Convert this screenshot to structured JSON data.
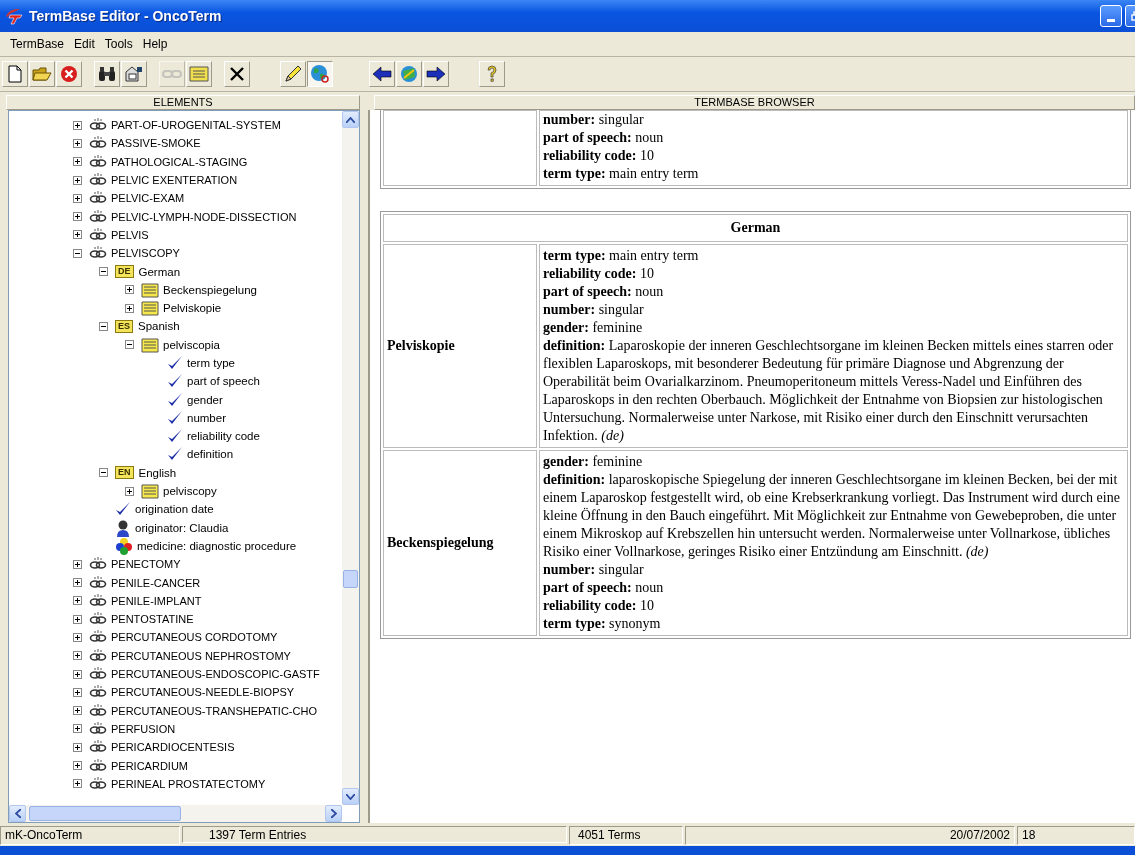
{
  "window": {
    "title": "TermBase Editor - OncoTerm"
  },
  "menu": [
    "TermBase",
    "Edit",
    "Tools",
    "Help"
  ],
  "toolbar": [
    [
      {
        "kind": "new"
      },
      {
        "kind": "open"
      },
      {
        "kind": "stop"
      }
    ],
    [
      {
        "kind": "find"
      },
      {
        "kind": "properties"
      }
    ],
    [
      {
        "kind": "link",
        "disabled": true
      },
      {
        "kind": "entry"
      }
    ],
    [
      {
        "kind": "delete"
      }
    ],
    [
      {
        "kind": "edit",
        "pressed": false
      },
      {
        "kind": "browse",
        "pressed": true
      }
    ],
    [
      {
        "kind": "back"
      },
      {
        "kind": "sync"
      },
      {
        "kind": "forward"
      }
    ],
    [
      {
        "kind": "help"
      }
    ]
  ],
  "tree": {
    "header": "ELEMENTS",
    "items": [
      {
        "kind": "concept",
        "label": "PART-OF-UROGENITAL-SYSTEM",
        "expanded": false
      },
      {
        "kind": "concept",
        "label": "PASSIVE-SMOKE",
        "expanded": false
      },
      {
        "kind": "concept",
        "label": "PATHOLOGICAL-STAGING",
        "expanded": false
      },
      {
        "kind": "concept",
        "label": "PELVIC EXENTERATION",
        "expanded": false
      },
      {
        "kind": "concept",
        "label": "PELVIC-EXAM",
        "expanded": false
      },
      {
        "kind": "concept",
        "label": "PELVIC-LYMPH-NODE-DISSECTION",
        "expanded": false
      },
      {
        "kind": "concept",
        "label": "PELVIS",
        "expanded": false
      },
      {
        "kind": "concept",
        "label": "PELVISCOPY",
        "expanded": true,
        "children": [
          {
            "kind": "language",
            "badge": "DE",
            "label": "German",
            "expanded": true,
            "children": [
              {
                "kind": "term",
                "label": "Beckenspiegelung",
                "expanded": false
              },
              {
                "kind": "term",
                "label": "Pelviskopie",
                "expanded": false
              }
            ]
          },
          {
            "kind": "language",
            "badge": "ES",
            "label": "Spanish",
            "expanded": true,
            "children": [
              {
                "kind": "term",
                "label": "pelviscopia",
                "expanded": true,
                "children": [
                  {
                    "kind": "field",
                    "label": "term type"
                  },
                  {
                    "kind": "field",
                    "label": "part of speech"
                  },
                  {
                    "kind": "field",
                    "label": "gender"
                  },
                  {
                    "kind": "field",
                    "label": "number"
                  },
                  {
                    "kind": "field",
                    "label": "reliability code"
                  },
                  {
                    "kind": "field",
                    "label": "definition"
                  }
                ]
              }
            ]
          },
          {
            "kind": "language",
            "badge": "EN",
            "label": "English",
            "expanded": true,
            "children": [
              {
                "kind": "term",
                "label": "pelviscopy",
                "expanded": false
              }
            ]
          },
          {
            "kind": "field",
            "label": "origination date"
          },
          {
            "kind": "person",
            "label": "originator: Claudia"
          },
          {
            "kind": "subject",
            "label": "medicine: diagnostic procedure"
          }
        ]
      },
      {
        "kind": "concept",
        "label": "PENECTOMY",
        "expanded": false
      },
      {
        "kind": "concept",
        "label": "PENILE-CANCER",
        "expanded": false
      },
      {
        "kind": "concept",
        "label": "PENILE-IMPLANT",
        "expanded": false
      },
      {
        "kind": "concept",
        "label": "PENTOSTATINE",
        "expanded": false
      },
      {
        "kind": "concept",
        "label": "PERCUTANEOUS CORDOTOMY",
        "expanded": false
      },
      {
        "kind": "concept",
        "label": "PERCUTANEOUS NEPHROSTOMY",
        "expanded": false
      },
      {
        "kind": "concept",
        "label": "PERCUTANEOUS-ENDOSCOPIC-GASTF",
        "expanded": false
      },
      {
        "kind": "concept",
        "label": "PERCUTANEOUS-NEEDLE-BIOPSY",
        "expanded": false
      },
      {
        "kind": "concept",
        "label": "PERCUTANEOUS-TRANSHEPATIC-CHO",
        "expanded": false
      },
      {
        "kind": "concept",
        "label": "PERFUSION",
        "expanded": false
      },
      {
        "kind": "concept",
        "label": "PERICARDIOCENTESIS",
        "expanded": false
      },
      {
        "kind": "concept",
        "label": "PERICARDIUM",
        "expanded": false
      },
      {
        "kind": "concept",
        "label": "PERINEAL PROSTATECTOMY",
        "expanded": false
      }
    ]
  },
  "browser": {
    "header": "TERMBASE BROWSER",
    "previous_fields": [
      "**number:** singular",
      "**part of speech:** noun",
      "**reliability code:** 10",
      "**term type:** main entry term"
    ],
    "language_table": {
      "title": "German",
      "terms": [
        {
          "term": "Pelviskopie",
          "fields": [
            "**term type:** main entry term",
            "**reliability code:** 10",
            "**part of speech:** noun",
            "**number:** singular",
            "**gender:** feminine",
            "**definition:** Laparoskopie der inneren Geschlechtsorgane im kleinen Becken mittels eines starren oder flexiblen Laparoskops, mit besonderer Bedeutung für primäre Diagnose und Abgrenzung der Operabilität beim Ovarialkarzinom. Pneumoperitoneum mittels Veress-Nadel und Einführen des Laparoskops in den rechten Oberbauch. Möglichkeit der Entnahme von Biopsien zur histologischen Untersuchung. Normalerweise unter Narkose, mit Risiko einer durch den Einschnitt verursachten Infektion. *(de)*"
          ]
        },
        {
          "term": "Beckenspiegelung",
          "fields": [
            "**gender:** feminine",
            "**definition:** laparoskopische Spiegelung der inneren Geschlechtsorgane im kleinen Becken, bei der mit einem Laparoskop festgestellt wird, ob eine Krebserkrankung vorliegt. Das Instrument wird durch eine kleine Öffnung in den Bauch eingeführt. Mit Möglichkeit zur Entnahme von Gewebeproben, die unter einem Mikroskop auf Krebszellen hin untersucht werden. Normalerweise unter Vollnarkose, übliches Risiko einer Vollnarkose, geringes Risiko einer Entzündung am Einschnitt. *(de)*",
            "**number:** singular",
            "**part of speech:** noun",
            "**reliability code:** 10",
            "**term type:** synonym"
          ]
        }
      ]
    }
  },
  "status_bar": [
    "mK-OncoTerm",
    "1397 Term Entries",
    "4051 Terms",
    "20/07/2002",
    "18"
  ]
}
